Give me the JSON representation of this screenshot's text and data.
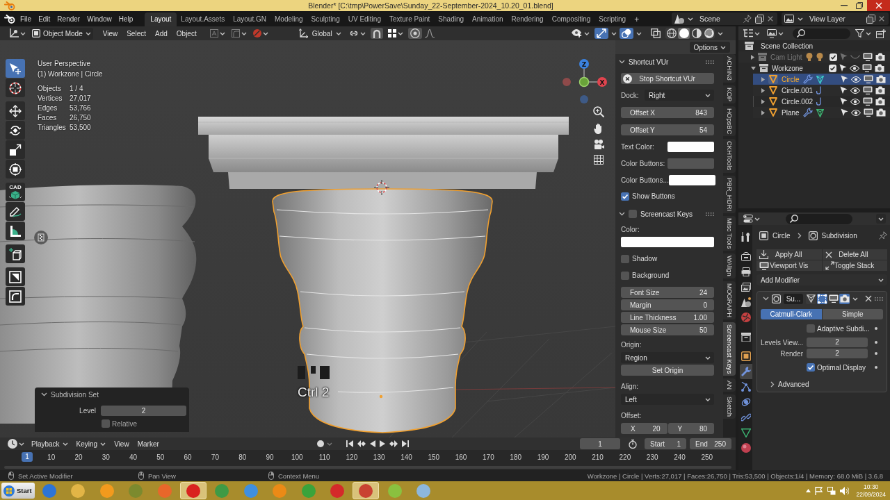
{
  "window": {
    "title": "Blender* [C:\\tmp\\PowerSave\\Sunday_22-September-2024_10.20_01.blend]"
  },
  "top_bar": {
    "menus": [
      "File",
      "Edit",
      "Render",
      "Window",
      "Help"
    ],
    "workspaces": [
      {
        "label": "Layout",
        "selected": true
      },
      {
        "label": "Layout.Assets",
        "selected": false
      },
      {
        "label": "Layout.GN",
        "selected": false
      },
      {
        "label": "Modeling",
        "selected": false
      },
      {
        "label": "Sculpting",
        "selected": false
      },
      {
        "label": "UV Editing",
        "selected": false
      },
      {
        "label": "Texture Paint",
        "selected": false
      },
      {
        "label": "Shading",
        "selected": false
      },
      {
        "label": "Animation",
        "selected": false
      },
      {
        "label": "Rendering",
        "selected": false
      },
      {
        "label": "Compositing",
        "selected": false
      },
      {
        "label": "Scripting",
        "selected": false
      }
    ],
    "add_workspace": "+",
    "scene": "Scene",
    "view_layer": "View Layer"
  },
  "viewport_header": {
    "mode": "Object Mode",
    "menus": [
      "View",
      "Select",
      "Add",
      "Object"
    ],
    "orientation": "Global",
    "gizmos": true,
    "overlays": true,
    "xray": false,
    "shading": [
      {
        "selected": false
      },
      {
        "selected": true
      },
      {
        "selected": false
      },
      {
        "selected": false
      }
    ],
    "options": "Options"
  },
  "viewport": {
    "view_name": "User Perspective",
    "context": "(1) Workzone | Circle",
    "stats": [
      {
        "label": "Objects",
        "value": "1 / 4"
      },
      {
        "label": "Vertices",
        "value": "27,017"
      },
      {
        "label": "Edges",
        "value": "53,766"
      },
      {
        "label": "Faces",
        "value": "26,750"
      },
      {
        "label": "Triangles",
        "value": "53,500"
      }
    ],
    "gizmo": {
      "z": "Z",
      "x": "X"
    },
    "tools": [
      {
        "selected": true
      },
      {
        "selected": false
      },
      {
        "selected": false
      },
      {
        "selected": false
      },
      {
        "selected": false
      },
      {
        "selected": false
      },
      {
        "label": "CAD",
        "selected": false
      },
      {
        "selected": false
      },
      {
        "selected": false
      },
      {
        "selected": false
      },
      {
        "selected": false
      },
      {
        "selected": false
      }
    ],
    "keys_overlay": "Ctrl 2",
    "last_operator": {
      "title": "Subdivision Set",
      "expanded": true,
      "level_label": "Level",
      "level": "2",
      "relative": {
        "label": "Relative",
        "checked": false
      }
    }
  },
  "sidebar": {
    "tabs": [
      {
        "label": "ACHIN3",
        "selected": false
      },
      {
        "label": "KOP",
        "selected": false
      },
      {
        "label": "HOpsBC",
        "selected": false
      },
      {
        "label": "CKHTools",
        "selected": false
      },
      {
        "label": "PBR_HDRI",
        "selected": false
      },
      {
        "label": "Misc Tools",
        "selected": false
      },
      {
        "label": "WAlign",
        "selected": false
      },
      {
        "label": "MOGRAPH",
        "selected": false
      },
      {
        "label": "Screencast Keys",
        "selected": true
      },
      {
        "label": "AN",
        "selected": false
      },
      {
        "label": "Sketch",
        "selected": false
      }
    ],
    "shortcut_vur": {
      "title": "Shortcut VUr",
      "expanded": true,
      "stop_button": "Stop Shortcut VUr",
      "dock_label": "Dock:",
      "dock": "Right",
      "fields": [
        {
          "label": "Offset X",
          "value": "843"
        },
        {
          "label": "Offset Y",
          "value": "54"
        }
      ],
      "colors": [
        {
          "label": "Text Color:",
          "color": "#ffffff"
        },
        {
          "label": "Color Buttons:",
          "color": "#545454"
        },
        {
          "label": "Color Buttons...",
          "color": "#ffffff"
        }
      ],
      "show_buttons": {
        "label": "Show Buttons",
        "checked": true
      }
    },
    "screencast_keys": {
      "title": "Screencast Keys",
      "expanded": true,
      "enabled": false,
      "color_label": "Color:",
      "color": "#ffffff",
      "checks": [
        {
          "label": "Shadow",
          "checked": false
        },
        {
          "label": "Background",
          "checked": false
        }
      ],
      "fields": [
        {
          "label": "Font Size",
          "value": "24"
        },
        {
          "label": "Margin",
          "value": "0"
        },
        {
          "label": "Line Thickness",
          "value": "1.00"
        },
        {
          "label": "Mouse Size",
          "value": "50"
        }
      ],
      "origin_label": "Origin:",
      "origin": "Region",
      "set_origin": "Set Origin",
      "align_label": "Align:",
      "align": "Left",
      "offset_label": "Offset:",
      "offset": [
        {
          "label": "X",
          "value": "20"
        },
        {
          "label": "Y",
          "value": "80"
        }
      ]
    }
  },
  "outliner": {
    "root": "Scene Collection",
    "tree": [
      {
        "name": "Cam Light",
        "kind": "collection",
        "expanded": false,
        "included": true,
        "disabled": true,
        "selected": false
      },
      {
        "name": "Workzone",
        "kind": "collection",
        "expanded": true,
        "included": true,
        "disabled": false,
        "selected": false,
        "children": [
          {
            "name": "Circle",
            "kind": "mesh",
            "expanded": false,
            "modifiers": true,
            "selected": true
          },
          {
            "name": "Circle.001",
            "kind": "mesh",
            "expanded": false,
            "modifiers": false,
            "selected": false
          },
          {
            "name": "Circle.002",
            "kind": "mesh",
            "expanded": false,
            "modifiers": false,
            "selected": false
          },
          {
            "name": "Plane",
            "kind": "mesh",
            "expanded": false,
            "modifiers": true,
            "selected": false
          }
        ]
      }
    ]
  },
  "properties": {
    "tabs": [
      {
        "selected": false
      },
      {
        "selected": false
      },
      {
        "selected": false
      },
      {
        "selected": false
      },
      {
        "selected": false
      },
      {
        "selected": false
      },
      {
        "selected": false
      },
      {
        "selected": false
      },
      {
        "selected": true
      },
      {
        "selected": false
      },
      {
        "selected": false
      },
      {
        "selected": false
      },
      {
        "selected": false
      },
      {
        "selected": false
      }
    ],
    "breadcrumb": [
      "Circle",
      "Subdivision"
    ],
    "actions": [
      "Apply All",
      "Delete All",
      "Viewport Vis",
      "Toggle Stack"
    ],
    "add_modifier": "Add Modifier",
    "modifier": {
      "name": "Su...",
      "expanded": true,
      "toggles": [
        {
          "on": false
        },
        {
          "on": true
        },
        {
          "on": false
        },
        {
          "on": true
        }
      ],
      "types": [
        {
          "label": "Catmull-Clark",
          "selected": true
        },
        {
          "label": "Simple",
          "selected": false
        }
      ],
      "adaptive": {
        "label": "Adaptive Subdi...",
        "checked": false
      },
      "levels": [
        {
          "label": "Levels View...",
          "value": "2"
        },
        {
          "label": "Render",
          "value": "2"
        }
      ],
      "optimal": {
        "label": "Optimal Display",
        "checked": true
      },
      "advanced": {
        "label": "Advanced",
        "expanded": false
      }
    }
  },
  "timeline": {
    "menus": [
      {
        "label": "Playback",
        "dropdown": true
      },
      {
        "label": "Keying",
        "dropdown": true
      },
      {
        "label": "View",
        "dropdown": false
      },
      {
        "label": "Marker",
        "dropdown": false
      }
    ],
    "current_frame": "1",
    "start_label": "Start",
    "start": "1",
    "end_label": "End",
    "end": "250",
    "playhead": "1",
    "ruler": [
      "10",
      "20",
      "30",
      "40",
      "50",
      "60",
      "70",
      "80",
      "90",
      "100",
      "110",
      "120",
      "130",
      "140",
      "150",
      "160",
      "170",
      "180",
      "190",
      "200",
      "210",
      "220",
      "230",
      "240",
      "250"
    ]
  },
  "status_bar": {
    "hints": [
      "Set Active Modifier",
      "Pan View",
      "Context Menu"
    ],
    "info": "Workzone | Circle | Verts:27,017 | Faces:26,750 | Tris:53,500 | Objects:1/4 | Memory: 68.0 MiB | 3.6.8"
  },
  "taskbar": {
    "start": "Start",
    "apps": [
      {
        "color": "#2d74d6",
        "active": false
      },
      {
        "color": "#e2b546",
        "active": false
      },
      {
        "color": "#f39a1d",
        "active": false
      },
      {
        "color": "#7c8a2e",
        "active": false
      },
      {
        "color": "#e8672a",
        "active": false
      },
      {
        "color": "#d9231f",
        "active": true
      },
      {
        "color": "#3f9a45",
        "active": false
      },
      {
        "color": "#3f8fe0",
        "active": false
      },
      {
        "color": "#eb8a16",
        "active": false
      },
      {
        "color": "#3aa33b",
        "active": false
      },
      {
        "color": "#d42a2a",
        "active": false
      },
      {
        "color": "#c94231",
        "active": true
      },
      {
        "color": "#8ac13f",
        "active": false
      },
      {
        "color": "#8db7dc",
        "active": false
      }
    ],
    "time": "10:30",
    "date": "22/09/2024"
  }
}
